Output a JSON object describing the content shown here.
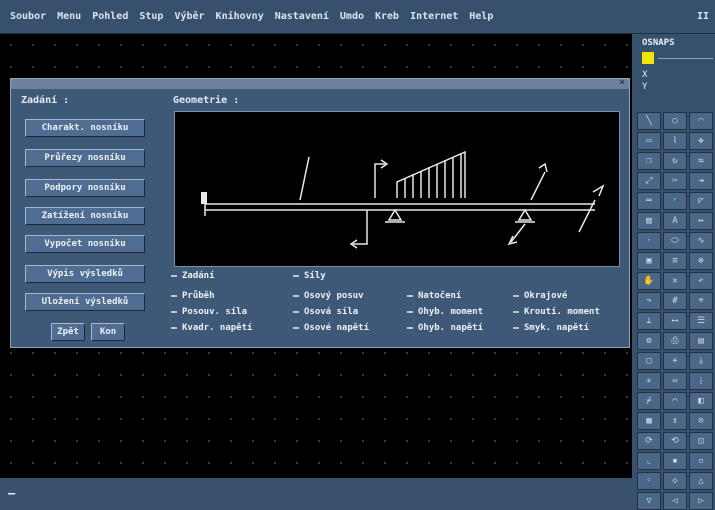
{
  "menubar": {
    "items": [
      "Soubor",
      "Menu",
      "Pohled",
      "Stup",
      "Výběr",
      "Knihovny",
      "Nastavení",
      "Umdo",
      "Kreb",
      "Internet",
      "Help"
    ],
    "right": "II"
  },
  "sidepanel": {
    "osnap_label": "OSNAPS",
    "coord_x": "X",
    "coord_y": "Y"
  },
  "dialog": {
    "zadani_label": "Zadání :",
    "geometrie_label": "Geometrie :",
    "buttons": [
      "Charakt. nosníku",
      "Průřezy nosníku",
      "Podpory nosníku",
      "Zatížení nosníku",
      "Vypočet nosníku",
      "Výpis výsledků",
      "Uložení výsledků"
    ],
    "back_button": "Zpět",
    "next_button": "Kon",
    "results": [
      [
        "Zadání",
        "Síly",
        "",
        ""
      ],
      [
        "Průběh",
        "Osový posuv",
        "Natočení",
        "Okrajové"
      ],
      [
        "Posouv. síla",
        "Osová síla",
        "Ohyb. moment",
        "Kroutí. moment"
      ],
      [
        "Kvadr. napětí",
        "Osové napětí",
        "Ohyb. napětí",
        "Smyk. napětí"
      ]
    ]
  },
  "colors": {
    "accent": "#37506c",
    "highlight": "#f2e300",
    "dialog": "#3e5878"
  }
}
